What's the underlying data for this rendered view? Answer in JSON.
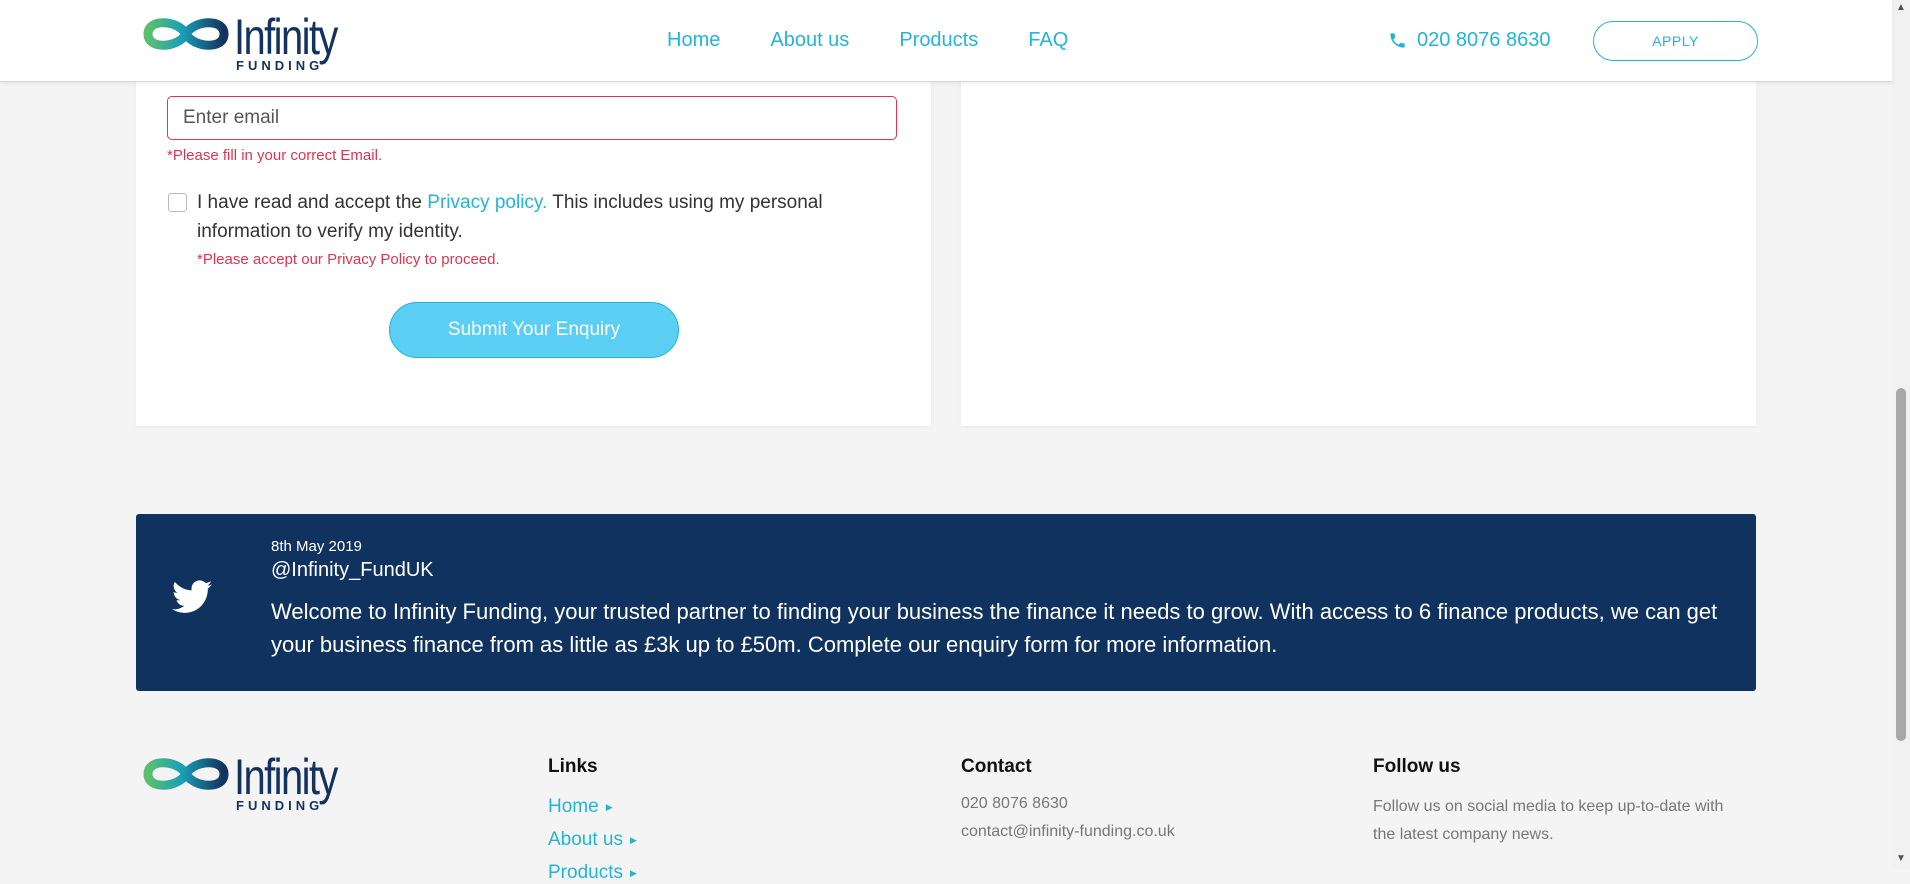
{
  "header": {
    "logo": {
      "brand": "Infinity",
      "sub": "FUNDING"
    },
    "nav": [
      "Home",
      "About us",
      "Products",
      "FAQ"
    ],
    "phone": "020 8076 8630",
    "apply_label": "APPLY"
  },
  "form": {
    "email_placeholder": "Enter email",
    "email_error": "*Please fill in your correct Email.",
    "consent_before": "I have read and accept the ",
    "consent_link": "Privacy policy.",
    "consent_after": " This includes using my personal information to verify my identity.",
    "consent_error": "*Please accept our Privacy Policy to proceed.",
    "submit_label": "Submit Your Enquiry"
  },
  "tweet": {
    "date": "8th May 2019",
    "handle": "@Infinity_FundUK",
    "text": "Welcome to Infinity Funding, your trusted partner to finding your business the finance it needs to grow. With access to 6 finance products, we can get your business finance from as little as £3k up to £50m. Complete our enquiry form for more information."
  },
  "footer": {
    "logo": {
      "brand": "Infinity",
      "sub": "FUNDING"
    },
    "links_title": "Links",
    "links": [
      "Home",
      "About us",
      "Products"
    ],
    "contact_title": "Contact",
    "contact_phone": "020 8076 8630",
    "contact_email": "contact@infinity-funding.co.uk",
    "follow_title": "Follow us",
    "follow_text": "Follow us on social media to keep up-to-date with the latest company news."
  },
  "colors": {
    "accent": "#23b5d7",
    "navy": "#10325f",
    "error": "#e0334f",
    "button": "#5bcef3"
  },
  "icons": [
    "infinity-logo-icon",
    "phone-icon",
    "twitter-icon",
    "triangle-right-icon"
  ]
}
